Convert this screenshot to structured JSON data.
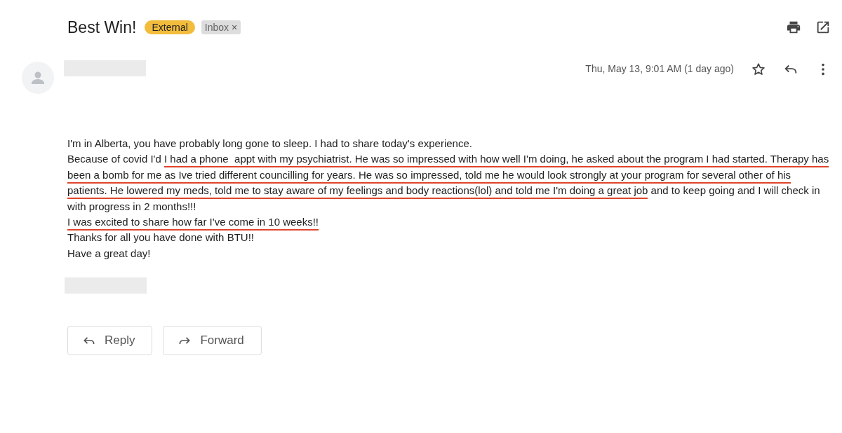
{
  "subject": "Best Win!",
  "labels": [
    {
      "text": "External",
      "kind": "external",
      "removable": false
    },
    {
      "text": "Inbox",
      "kind": "folder",
      "removable": true,
      "remove_glyph": "×"
    }
  ],
  "header": {
    "date": "Thu, May 13, 9:01 AM (1 day ago)",
    "starred": false
  },
  "body": [
    {
      "segments": [
        {
          "text": "I'm in Alberta, you have probably long gone to sleep. I had to share today's experience.",
          "underlined": false
        }
      ]
    },
    {
      "segments": [
        {
          "text": "Because of covid I'd ",
          "underlined": false
        },
        {
          "text": "I had a phone  appt with my psychiatrist. He was so impressed with how well I'm doing, he asked about the program I had started. Therapy has",
          "underlined": true
        }
      ]
    },
    {
      "segments": [
        {
          "text": "been a bomb for me as Ive tried different councilling for years. He was so impressed, told me he would look strongly at your program for several other of his",
          "underlined": true
        }
      ]
    },
    {
      "segments": [
        {
          "text": "patients. He lowered my meds, told me to stay aware of my feelings and body reactions(lol) and told me I'm doing a great job",
          "underlined": true
        },
        {
          "text": " and to keep going and I will check in",
          "underlined": false
        }
      ]
    },
    {
      "segments": [
        {
          "text": "with progress in 2 months!!!",
          "underlined": false
        }
      ]
    },
    {
      "segments": [
        {
          "text": "I was excited to share how far I've come in 10 weeks!!",
          "underlined": true
        }
      ]
    },
    {
      "segments": [
        {
          "text": "Thanks for all you have done with BTU!!",
          "underlined": false
        }
      ]
    },
    {
      "segments": [
        {
          "text": "Have a great day!",
          "underlined": false
        }
      ]
    }
  ],
  "actions": [
    {
      "label": "Reply",
      "kind": "reply"
    },
    {
      "label": "Forward",
      "kind": "forward"
    }
  ]
}
